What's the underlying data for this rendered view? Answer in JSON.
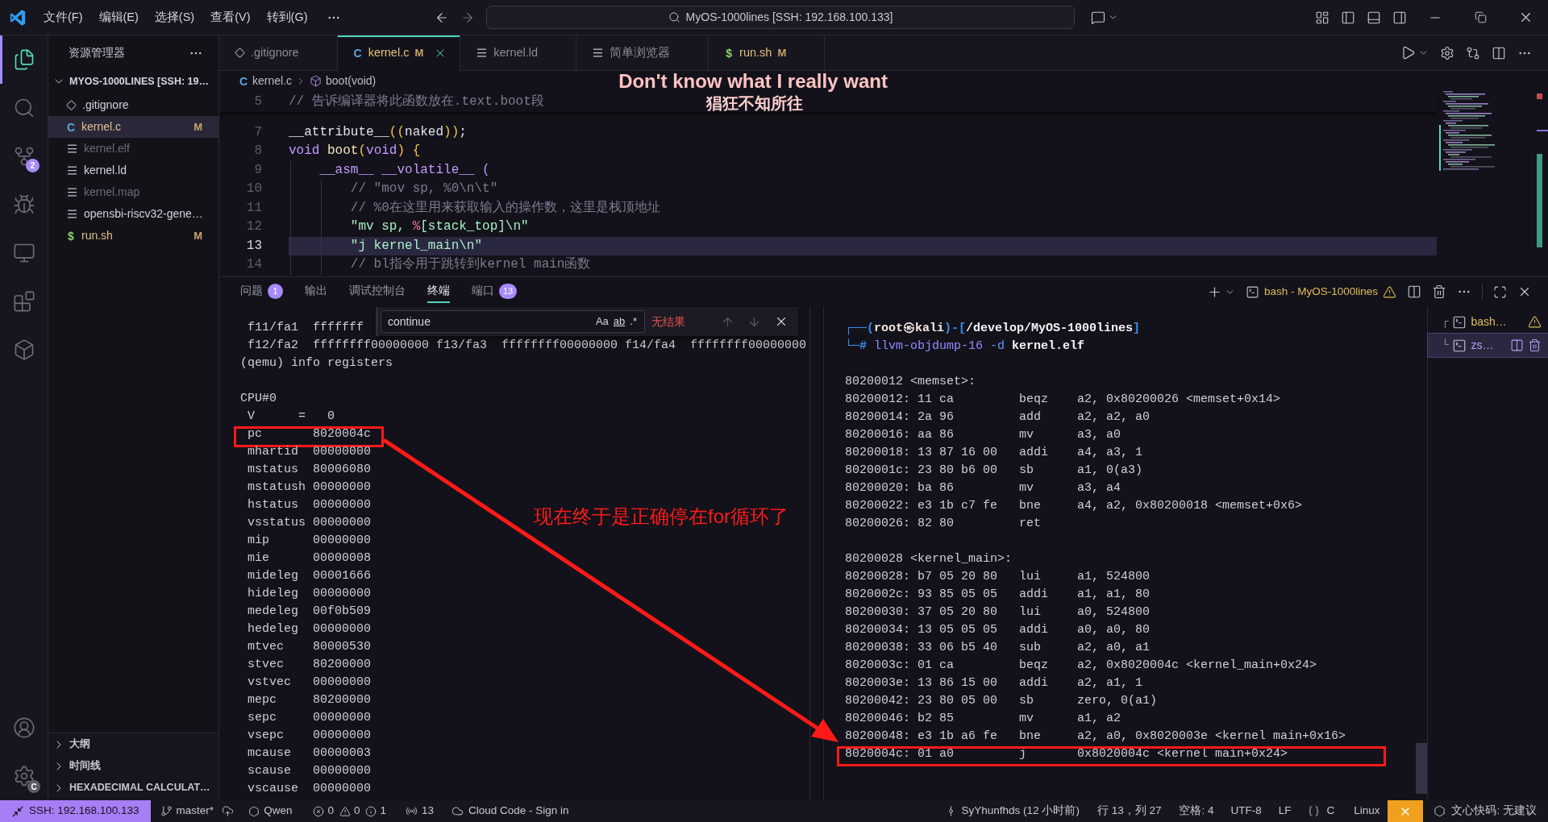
{
  "title_bar": {
    "menus": [
      "文件(F)",
      "编辑(E)",
      "选择(S)",
      "查看(V)",
      "转到(G)"
    ],
    "command_center": "MyOS-1000lines [SSH: 192.168.100.133]"
  },
  "activity_bar": {
    "items": [
      {
        "kind": "explorer",
        "selected": true
      },
      {
        "kind": "search",
        "selected": false
      },
      {
        "kind": "source_control",
        "selected": false,
        "badge": "2"
      },
      {
        "kind": "run_debug",
        "selected": false
      },
      {
        "kind": "remote",
        "selected": false
      },
      {
        "kind": "extensions",
        "selected": false
      },
      {
        "kind": "cube",
        "selected": false
      }
    ],
    "bottom": [
      {
        "kind": "accounts"
      },
      {
        "kind": "manage",
        "badge": "C"
      }
    ]
  },
  "sidebar": {
    "title": "资源管理器",
    "folder": {
      "label": "MYOS-1000LINES [SSH: 19…",
      "expanded": true,
      "files": [
        {
          "name": ".gitignore",
          "kind": "gitignore",
          "selected": false,
          "ignored": false
        },
        {
          "name": "kernel.c",
          "kind": "c",
          "glyph": "C",
          "status": "M",
          "selected": true,
          "ignored": false
        },
        {
          "name": "kernel.elf",
          "kind": "text",
          "selected": false,
          "ignored": true
        },
        {
          "name": "kernel.ld",
          "kind": "text",
          "selected": false,
          "ignored": false
        },
        {
          "name": "kernel.map",
          "kind": "text",
          "selected": false,
          "ignored": true
        },
        {
          "name": "opensbi-riscv32-gene…",
          "kind": "text",
          "selected": false,
          "ignored": false
        },
        {
          "name": "run.sh",
          "kind": "shell",
          "glyph": "$",
          "status": "M",
          "selected": false,
          "ignored": false
        }
      ]
    },
    "sections": [
      {
        "label": "大纲",
        "expanded": false
      },
      {
        "label": "时间线",
        "expanded": false
      },
      {
        "label": "HEXADECIMAL CALCULAT…",
        "expanded": false
      }
    ]
  },
  "editor": {
    "tabs": [
      {
        "label": ".gitignore",
        "kind": "gitignore",
        "selected": false
      },
      {
        "label": "kernel.c",
        "kind": "c",
        "glyph": "C",
        "status": "M",
        "selected": true
      },
      {
        "label": "kernel.ld",
        "kind": "text",
        "selected": false
      },
      {
        "label": "简单浏览器",
        "kind": "text",
        "selected": false
      },
      {
        "label": "run.sh",
        "kind": "shell",
        "glyph": "$",
        "status": "M",
        "selected": false
      }
    ],
    "breadcrumb": [
      {
        "kind": "c",
        "glyph": "C",
        "label": "kernel.c"
      },
      {
        "kind": "symbol",
        "label": "boot(void)"
      }
    ],
    "lines": [
      {
        "kind": "sticky",
        "number": "5",
        "current": false,
        "tokens": [
          {
            "kind": "comment",
            "text": "// 告诉编译器将此函数放在.text.boot段"
          }
        ]
      },
      {
        "kind": "code",
        "number": "7",
        "current": false,
        "tokens": [
          {
            "kind": "plain",
            "text": "__attribute__"
          },
          {
            "kind": "bracket",
            "text": "(("
          },
          {
            "kind": "plain",
            "text": "naked"
          },
          {
            "kind": "bracket",
            "text": "))"
          },
          {
            "kind": "plain",
            "text": ";"
          }
        ]
      },
      {
        "kind": "code",
        "number": "8",
        "current": false,
        "tokens": [
          {
            "kind": "keyword",
            "text": "void "
          },
          {
            "kind": "function",
            "text": "boot"
          },
          {
            "kind": "bracket",
            "text": "("
          },
          {
            "kind": "keyword",
            "text": "void"
          },
          {
            "kind": "bracket",
            "text": ") {"
          }
        ]
      },
      {
        "kind": "code",
        "number": "9",
        "current": false,
        "tokens": [
          {
            "kind": "keyword",
            "text": "    __asm__ __volatile__ ("
          }
        ]
      },
      {
        "kind": "code",
        "number": "10",
        "current": false,
        "tokens": [
          {
            "kind": "comment",
            "text": "        // \"mov sp, %0\\n\\t\""
          }
        ]
      },
      {
        "kind": "code",
        "number": "11",
        "current": false,
        "tokens": [
          {
            "kind": "comment",
            "text": "        // %0在这里用来获取输入的操作数，这里是栈顶地址"
          }
        ]
      },
      {
        "kind": "code",
        "number": "12",
        "current": false,
        "tokens": [
          {
            "kind": "string",
            "text": "        \"mv sp, "
          },
          {
            "kind": "format",
            "text": "%"
          },
          {
            "kind": "string",
            "text": "[stack_top]\\n\""
          }
        ]
      },
      {
        "kind": "code",
        "number": "13",
        "current": true,
        "tokens": [
          {
            "kind": "string",
            "text": "        \"j kernel_main\\n\""
          }
        ]
      },
      {
        "kind": "code",
        "number": "14",
        "current": false,
        "tokens": [
          {
            "kind": "comment",
            "text": "        // bl指令用于跳转到kernel main函数"
          }
        ]
      }
    ]
  },
  "panel": {
    "tabs": [
      {
        "label": "问题",
        "badge": "1",
        "selected": false
      },
      {
        "label": "输出",
        "selected": false
      },
      {
        "label": "调试控制台",
        "selected": false
      },
      {
        "label": "终端",
        "selected": true
      },
      {
        "label": "端口",
        "badge": "13",
        "selected": false
      }
    ],
    "terminal_title": "bash - MyOS-1000lines",
    "find": {
      "value": "continue",
      "options": [
        {
          "kind": "case",
          "label": "Aa"
        },
        {
          "kind": "word",
          "label": "ab"
        },
        {
          "kind": "regex",
          "label": ".*"
        }
      ],
      "result": "无结果"
    },
    "left_terminal": {
      "lines": [
        {
          "kind": "output",
          "text": " f11/fa1  fffffff",
          "boxed": false
        },
        {
          "kind": "output",
          "text": " f12/fa2  ffffffff00000000 f13/fa3  ffffffff00000000 f14/fa4  ffffffff00000000",
          "boxed": false
        },
        {
          "kind": "output",
          "text": "(qemu) info registers",
          "boxed": false
        },
        {
          "kind": "blank"
        },
        {
          "kind": "output",
          "text": "CPU#0",
          "boxed": false
        },
        {
          "kind": "output",
          "text": " V      =   0",
          "boxed": false
        },
        {
          "kind": "output",
          "text": " pc       8020004c",
          "boxed": true
        },
        {
          "kind": "output",
          "text": " mhartid  00000000",
          "boxed": false
        },
        {
          "kind": "output",
          "text": " mstatus  80006080",
          "boxed": false
        },
        {
          "kind": "output",
          "text": " mstatush 00000000",
          "boxed": false
        },
        {
          "kind": "output",
          "text": " hstatus  00000000",
          "boxed": false
        },
        {
          "kind": "output",
          "text": " vsstatus 00000000",
          "boxed": false
        },
        {
          "kind": "output",
          "text": " mip      00000000",
          "boxed": false
        },
        {
          "kind": "output",
          "text": " mie      00000008",
          "boxed": false
        },
        {
          "kind": "output",
          "text": " mideleg  00001666",
          "boxed": false
        },
        {
          "kind": "output",
          "text": " hideleg  00000000",
          "boxed": false
        },
        {
          "kind": "output",
          "text": " medeleg  00f0b509",
          "boxed": false
        },
        {
          "kind": "output",
          "text": " hedeleg  00000000",
          "boxed": false
        },
        {
          "kind": "output",
          "text": " mtvec    80000530",
          "boxed": false
        },
        {
          "kind": "output",
          "text": " stvec    80200000",
          "boxed": false
        },
        {
          "kind": "output",
          "text": " vstvec   00000000",
          "boxed": false
        },
        {
          "kind": "output",
          "text": " mepc     80200000",
          "boxed": false
        },
        {
          "kind": "output",
          "text": " sepc     00000000",
          "boxed": false
        },
        {
          "kind": "output",
          "text": " vsepc    00000000",
          "boxed": false
        },
        {
          "kind": "output",
          "text": " mcause   00000003",
          "boxed": false
        },
        {
          "kind": "output",
          "text": " scause   00000000",
          "boxed": false
        },
        {
          "kind": "output",
          "text": " vscause  00000000",
          "boxed": false
        }
      ]
    },
    "right_terminal": {
      "lines": [
        {
          "kind": "prompt",
          "tokens": [
            {
              "kind": "frame",
              "text": "┌──("
            },
            {
              "kind": "user",
              "text": "root㉿kali"
            },
            {
              "kind": "frame",
              "text": ")-["
            },
            {
              "kind": "path",
              "text": "/develop/MyOS-1000lines"
            },
            {
              "kind": "frame",
              "text": "]"
            }
          ]
        },
        {
          "kind": "prompt",
          "tokens": [
            {
              "kind": "frame",
              "text": "└─# "
            },
            {
              "kind": "command",
              "text": "llvm-objdump-16"
            },
            {
              "kind": "flag",
              "text": " -d"
            },
            {
              "kind": "file",
              "text": " kernel.elf"
            }
          ]
        },
        {
          "kind": "blank"
        },
        {
          "kind": "output",
          "text": "80200012 <memset>:",
          "boxed": false
        },
        {
          "kind": "output",
          "text": "80200012: 11 ca         beqz    a2, 0x80200026 <memset+0x14>",
          "boxed": false
        },
        {
          "kind": "output",
          "text": "80200014: 2a 96         add     a2, a2, a0",
          "boxed": false
        },
        {
          "kind": "output",
          "text": "80200016: aa 86         mv      a3, a0",
          "boxed": false
        },
        {
          "kind": "output",
          "text": "80200018: 13 87 16 00   addi    a4, a3, 1",
          "boxed": false
        },
        {
          "kind": "output",
          "text": "8020001c: 23 80 b6 00   sb      a1, 0(a3)",
          "boxed": false
        },
        {
          "kind": "output",
          "text": "80200020: ba 86         mv      a3, a4",
          "boxed": false
        },
        {
          "kind": "output",
          "text": "80200022: e3 1b c7 fe   bne     a4, a2, 0x80200018 <memset+0x6>",
          "boxed": false
        },
        {
          "kind": "output",
          "text": "80200026: 82 80         ret",
          "boxed": false
        },
        {
          "kind": "blank"
        },
        {
          "kind": "output",
          "text": "80200028 <kernel_main>:",
          "boxed": false
        },
        {
          "kind": "output",
          "text": "80200028: b7 05 20 80   lui     a1, 524800",
          "boxed": false
        },
        {
          "kind": "output",
          "text": "8020002c: 93 85 05 05   addi    a1, a1, 80",
          "boxed": false
        },
        {
          "kind": "output",
          "text": "80200030: 37 05 20 80   lui     a0, 524800",
          "boxed": false
        },
        {
          "kind": "output",
          "text": "80200034: 13 05 05 05   addi    a0, a0, 80",
          "boxed": false
        },
        {
          "kind": "output",
          "text": "80200038: 33 06 b5 40   sub     a2, a0, a1",
          "boxed": false
        },
        {
          "kind": "output",
          "text": "8020003c: 01 ca         beqz    a2, 0x8020004c <kernel_main+0x24>",
          "boxed": false
        },
        {
          "kind": "output",
          "text": "8020003e: 13 86 15 00   addi    a2, a1, 1",
          "boxed": false
        },
        {
          "kind": "output",
          "text": "80200042: 23 80 05 00   sb      zero, 0(a1)",
          "boxed": false
        },
        {
          "kind": "output",
          "text": "80200046: b2 85         mv      a1, a2",
          "boxed": false
        },
        {
          "kind": "output",
          "text": "80200048: e3 1b a6 fe   bne     a2, a0, 0x8020003e <kernel main+0x16>",
          "boxed": false
        },
        {
          "kind": "output",
          "text": "8020004c: 01 a0         j       0x8020004c <kernel main+0x24>",
          "boxed": true
        }
      ]
    },
    "terminal_list": [
      {
        "tree": "┌",
        "label": "bash…",
        "warning": true,
        "selected": false
      },
      {
        "tree": "└",
        "label": "zs…",
        "warning": false,
        "selected": true
      }
    ]
  },
  "annotations": {
    "caption": "Don't know what I really want",
    "subcaption": "猖狂不知所往",
    "note": "现在终于是正确停在for循环了"
  },
  "status_bar": {
    "remote": "SSH: 192.168.100.133",
    "branch": "master*",
    "qwen": "Qwen",
    "problems": {
      "errors": "0",
      "warnings": "0",
      "infos": "1"
    },
    "ports": "13",
    "cloud_code": "Cloud Code - Sign in",
    "blame": "SyYhunfhds (12 小时前)",
    "position": "行 13，列 27",
    "indent": "空格: 4",
    "encoding": "UTF-8",
    "eol": "LF",
    "language": "C",
    "os": "Linux",
    "assistant_toggle": {
      "on": true
    },
    "assistant": "文心快码: 无建议"
  }
}
